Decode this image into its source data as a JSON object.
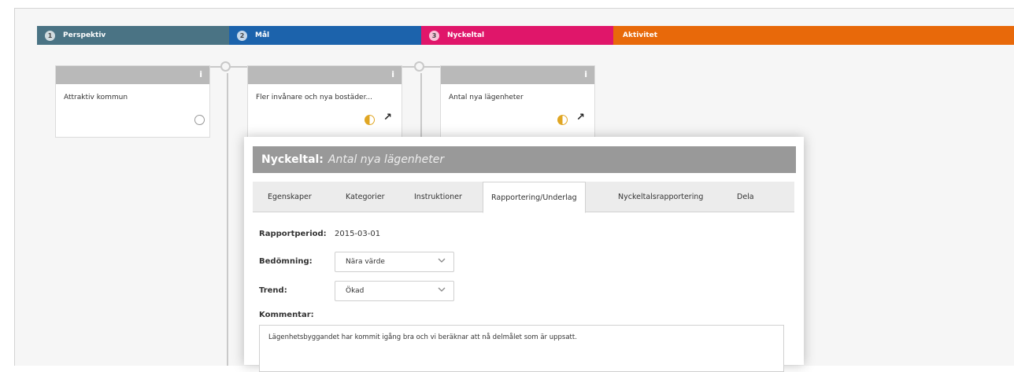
{
  "lanes": [
    {
      "num": "1",
      "label": "Perspektiv",
      "color": "#4a7384"
    },
    {
      "num": "2",
      "label": "Mål",
      "color": "#1c63ac"
    },
    {
      "num": "3",
      "label": "Nyckeltal",
      "color": "#e0166a"
    },
    {
      "num": "",
      "label": "Aktivitet",
      "color": "#e8690a"
    }
  ],
  "cards": [
    {
      "head_icon": "i",
      "text": "Attraktiv kommun",
      "status": "empty-circle"
    },
    {
      "head_icon": "i",
      "text": "Fler invånare och nya bostäder...",
      "status": "half-circle",
      "trend": "↗"
    },
    {
      "head_icon": "i",
      "text": "Antal nya lägenheter",
      "status": "half-circle",
      "trend": "↗"
    }
  ],
  "modal": {
    "title_lead": "Nyckeltal:",
    "title_name": "Antal nya lägenheter",
    "tabs": [
      "Egenskaper",
      "Kategorier",
      "Instruktioner",
      "Rapportering/Underlag",
      "Nyckeltalsrapportering",
      "Dela"
    ],
    "active_tab": "Rapportering/Underlag",
    "report_period_label": "Rapportperiod:",
    "report_period_value": "2015-03-01",
    "assessment_label": "Bedömning:",
    "assessment_value": "Nära värde",
    "trend_label": "Trend:",
    "trend_value": "Ökad",
    "comment_label": "Kommentar:",
    "comment_value": "Lägenhetsbyggandet har kommit igång bra och vi beräknar att nå delmålet som är uppsatt."
  }
}
